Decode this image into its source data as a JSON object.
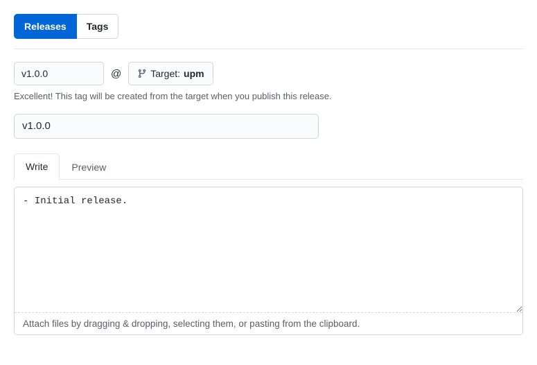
{
  "nav": {
    "releases_label": "Releases",
    "tags_label": "Tags"
  },
  "tag": {
    "value": "v1.0.0",
    "at_symbol": "@",
    "target_prefix": "Target:",
    "target_value": "upm",
    "hint": "Excellent! This tag will be created from the target when you publish this release."
  },
  "release": {
    "title_value": "v1.0.0"
  },
  "editor": {
    "write_label": "Write",
    "preview_label": "Preview",
    "body_value": "- Initial release.",
    "dropzone_text": "Attach files by dragging & dropping, selecting them, or pasting from the clipboard."
  }
}
